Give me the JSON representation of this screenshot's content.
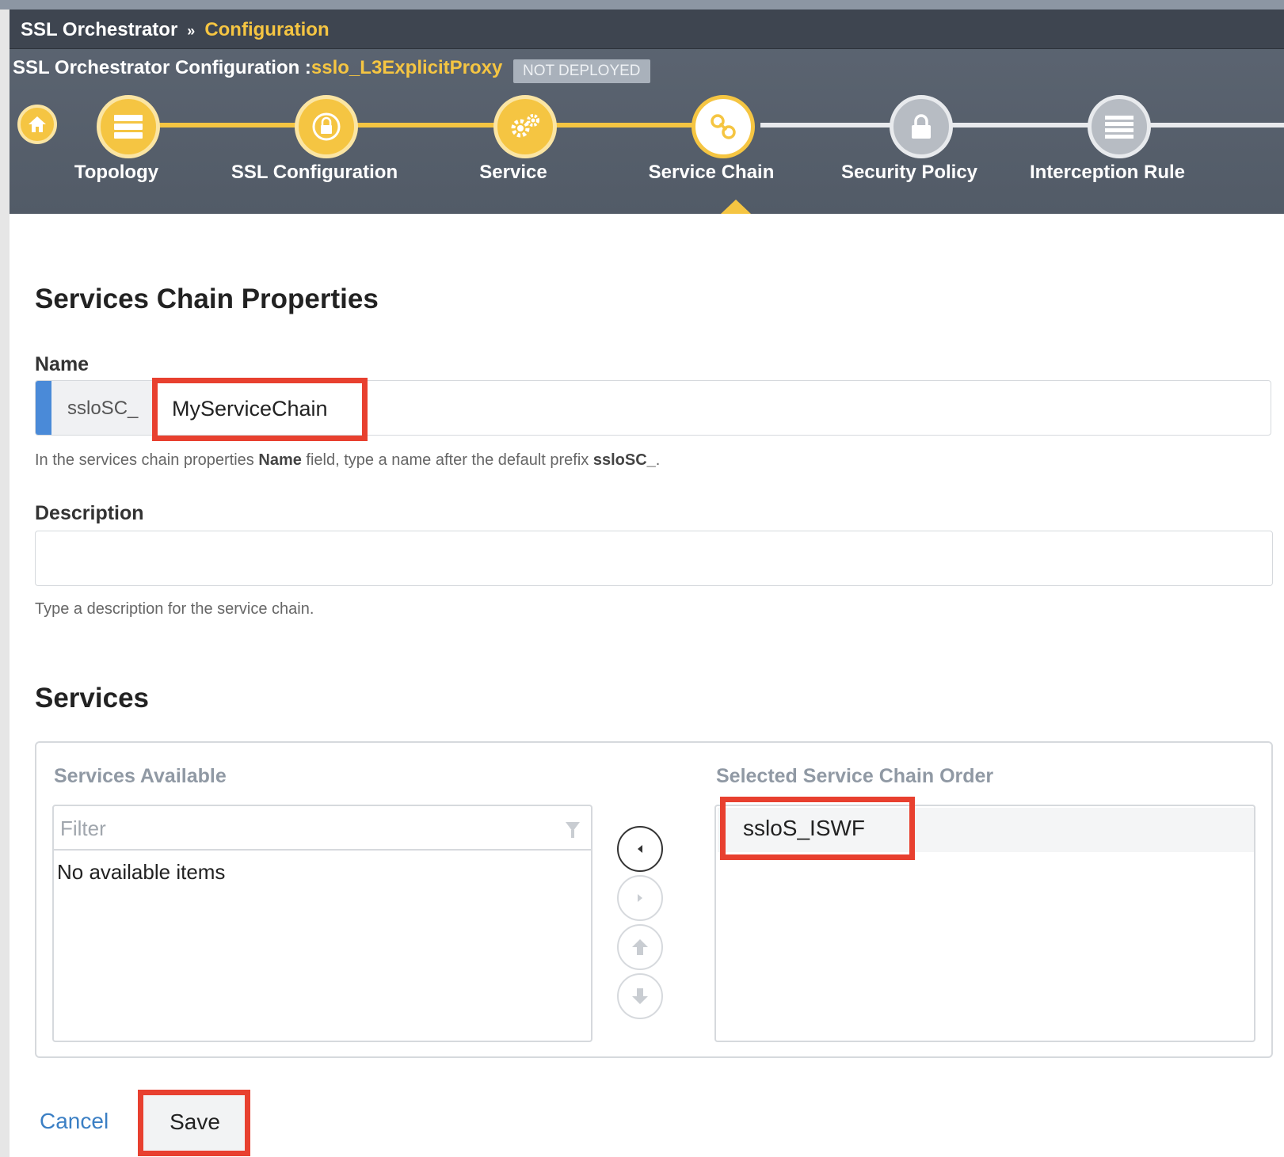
{
  "breadcrumb": {
    "root": "SSL Orchestrator",
    "separator": "»",
    "current": "Configuration"
  },
  "config": {
    "title_prefix": "SSL Orchestrator Configuration :",
    "name": "sslo_L3ExplicitProxy",
    "status": "NOT DEPLOYED"
  },
  "steps": [
    {
      "label": "Topology",
      "icon": "server-stack-icon",
      "state": "done"
    },
    {
      "label": "SSL Configuration",
      "icon": "lock-icon",
      "state": "done"
    },
    {
      "label": "Service",
      "icon": "gears-icon",
      "state": "done"
    },
    {
      "label": "Service Chain",
      "icon": "chain-link-icon",
      "state": "active"
    },
    {
      "label": "Security Policy",
      "icon": "padlock-icon",
      "state": "todo"
    },
    {
      "label": "Interception Rule",
      "icon": "list-icon",
      "state": "todo"
    }
  ],
  "properties": {
    "heading": "Services Chain Properties",
    "name_label": "Name",
    "name_prefix": "ssloSC_",
    "name_value": "MyServiceChain",
    "name_help_1": "In the services chain properties ",
    "name_help_bold_1": "Name",
    "name_help_2": " field, type a name after the default prefix ",
    "name_help_bold_2": "ssloSC_",
    "name_help_3": ".",
    "description_label": "Description",
    "description_value": "",
    "description_help": "Type a description for the service chain."
  },
  "services": {
    "heading": "Services",
    "available_title": "Services Available",
    "filter_placeholder": "Filter",
    "available_empty": "No available items",
    "selected_title": "Selected Service Chain Order",
    "selected_items": [
      "ssloS_ISWF"
    ]
  },
  "actions": {
    "cancel": "Cancel",
    "save": "Save"
  },
  "colors": {
    "accent": "#f5c542",
    "header": "#525b67",
    "link": "#3b7fc4",
    "highlight": "#e8402f"
  }
}
